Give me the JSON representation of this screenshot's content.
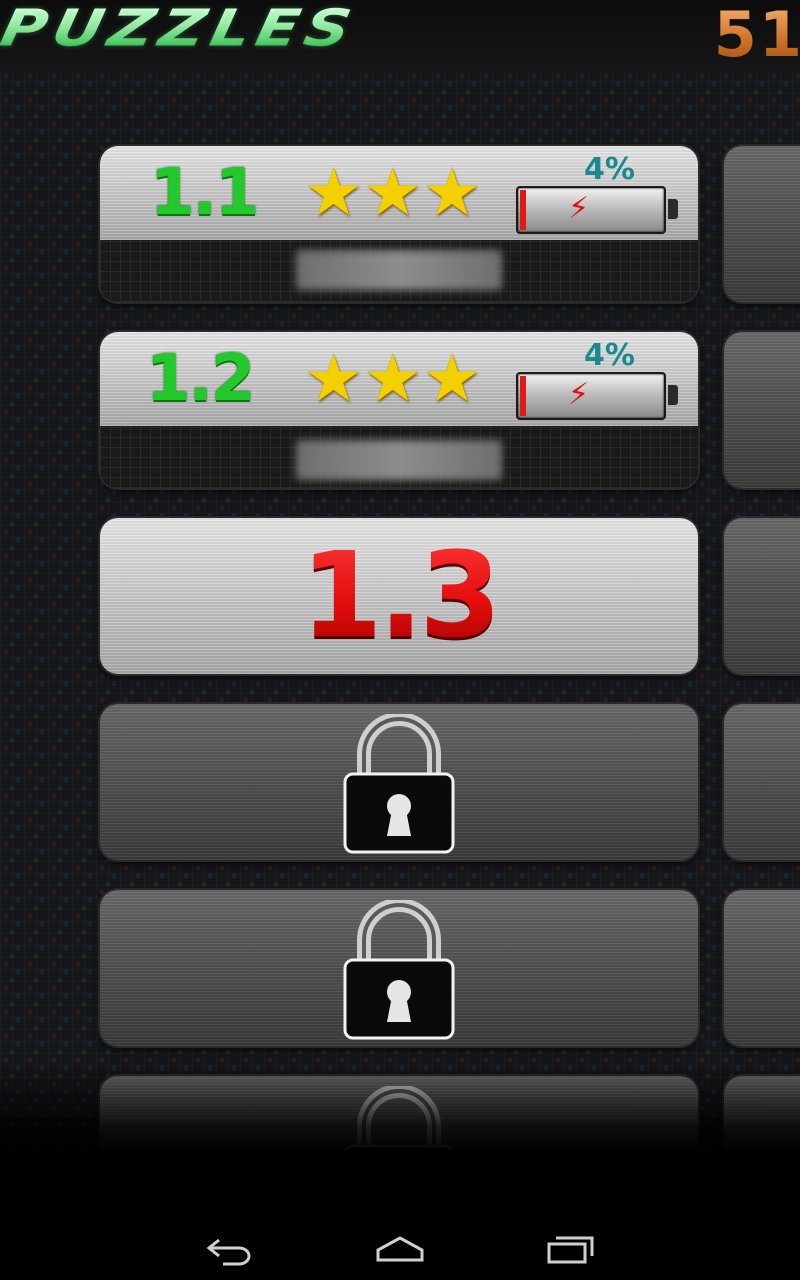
{
  "header": {
    "title": "PUZZLES",
    "score": "51"
  },
  "levels": [
    {
      "label": "1.1",
      "stars": "★★★",
      "progress_text": "4%",
      "progress_fraction": 0.04,
      "state": "completed"
    },
    {
      "label": "1.2",
      "stars": "★★★",
      "progress_text": "4%",
      "progress_fraction": 0.04,
      "state": "completed"
    },
    {
      "label": "1.3",
      "state": "current"
    },
    {
      "state": "locked"
    },
    {
      "state": "locked"
    },
    {
      "state": "locked"
    }
  ],
  "icons": {
    "star": "star-icon",
    "battery": "battery-icon",
    "lock": "padlock-icon",
    "back": "back-icon",
    "home": "home-icon",
    "recents": "recents-icon"
  },
  "colors": {
    "level_completed": "#22c92a",
    "level_current": "#e40d0d",
    "progress_text": "#1b8a8f",
    "score": "#d3742a",
    "star": "#f5d000"
  }
}
